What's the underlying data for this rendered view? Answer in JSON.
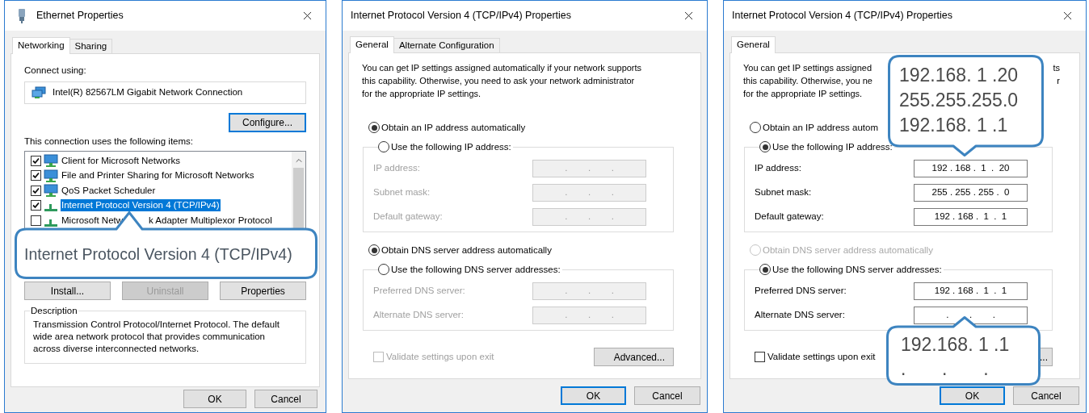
{
  "dialogs": [
    {
      "kind": "ethernet",
      "title": "Ethernet Properties",
      "tabs": [
        {
          "label": "Networking",
          "selected": true
        },
        {
          "label": "Sharing",
          "selected": false
        }
      ],
      "connect_label": "Connect using:",
      "adapter": "Intel(R) 82567LM Gigabit Network Connection",
      "configure_button": "Configure...",
      "items_label": "This connection uses the following items:",
      "items": [
        {
          "label": "Client for Microsoft Networks",
          "kind": "client",
          "checked": true,
          "selected": false
        },
        {
          "label": "File and Printer Sharing for Microsoft Networks",
          "kind": "client",
          "checked": true,
          "selected": false
        },
        {
          "label": "QoS Packet Scheduler",
          "kind": "client",
          "checked": true,
          "selected": false
        },
        {
          "label": "Internet Protocol Version 4 (TCP/IPv4)",
          "kind": "protocol",
          "checked": true,
          "selected": true
        },
        {
          "label": "Microsoft Netw",
          "tail": "k Adapter Multiplexor Protocol",
          "kind": "protocol",
          "checked": false,
          "selected": false
        }
      ],
      "buttons": [
        {
          "label": "Install...",
          "disabled": false
        },
        {
          "label": "Uninstall",
          "disabled": true
        },
        {
          "label": "Properties",
          "disabled": false
        }
      ],
      "description": {
        "legend": "Description",
        "text": "Transmission Control Protocol/Internet Protocol. The default wide area network protocol that provides communication across diverse interconnected networks."
      },
      "footer": [
        {
          "label": "OK",
          "focused": false
        },
        {
          "label": "Cancel",
          "focused": false
        }
      ],
      "callouts": [
        {
          "kind": "protocol",
          "lines": [
            "Internet Protocol Version 4 (TCP/IPv4)"
          ]
        }
      ]
    },
    {
      "kind": "ipv4",
      "title": "Internet Protocol Version 4 (TCP/IPv4) Properties",
      "tabs": [
        {
          "label": "General",
          "selected": true
        },
        {
          "label": "Alternate Configuration",
          "selected": false
        }
      ],
      "intro": [
        {
          "text": "You can get IP settings assigned automatically if your network supports"
        },
        {
          "text": "this capability. Otherwise, you need to ask your network administrator"
        },
        {
          "text": "for the appropriate IP settings."
        }
      ],
      "ip_modes": [
        {
          "label": "Obtain an IP address automatically",
          "selected": true,
          "disabled": false
        },
        {
          "label": "Use the following IP address:",
          "selected": false,
          "disabled": false
        }
      ],
      "ip_fields": [
        {
          "label": "IP address:",
          "value": ".        .        .",
          "disabled": true
        },
        {
          "label": "Subnet mask:",
          "value": ".        .        .",
          "disabled": true
        },
        {
          "label": "Default gateway:",
          "value": ".        .        .",
          "disabled": true
        }
      ],
      "dns_modes": [
        {
          "label": "Obtain DNS server address automatically",
          "selected": true,
          "disabled": false
        },
        {
          "label": "Use the following DNS server addresses:",
          "selected": false,
          "disabled": false
        }
      ],
      "dns_fields": [
        {
          "label": "Preferred DNS server:",
          "value": ".        .        .",
          "disabled": true
        },
        {
          "label": "Alternate DNS server:",
          "value": ".        .        .",
          "disabled": true
        }
      ],
      "validate": {
        "label": "Validate settings upon exit",
        "checked": false,
        "disabled": true
      },
      "advanced_button": "Advanced...",
      "footer": [
        {
          "label": "OK",
          "focused": true
        },
        {
          "label": "Cancel",
          "focused": false
        }
      ]
    },
    {
      "kind": "ipv4",
      "title": "Internet Protocol Version 4 (TCP/IPv4) Properties",
      "tabs": [
        {
          "label": "General",
          "selected": true
        }
      ],
      "intro": [
        {
          "text": "You can get IP settings assigned",
          "tail": "ts"
        },
        {
          "text": "this capability. Otherwise, you ne",
          "tail": "r"
        },
        {
          "text": "for the appropriate IP settings."
        }
      ],
      "ip_modes": [
        {
          "label": "Obtain an IP address autom",
          "selected": false,
          "disabled": false
        },
        {
          "label": "Use the following IP address:",
          "selected": true,
          "disabled": false
        }
      ],
      "ip_fields": [
        {
          "label": "IP address:",
          "value": "192 . 168 .  1  .  20",
          "disabled": false
        },
        {
          "label": "Subnet mask:",
          "value": "255 . 255 . 255 .  0",
          "disabled": false
        },
        {
          "label": "Default gateway:",
          "value": "192 . 168 .  1  .  1",
          "disabled": false
        }
      ],
      "dns_modes": [
        {
          "label": "Obtain DNS server address automatically",
          "selected": false,
          "disabled": true
        },
        {
          "label": "Use the following DNS server addresses:",
          "selected": true,
          "disabled": false
        }
      ],
      "dns_fields": [
        {
          "label": "Preferred DNS server:",
          "value": "192 . 168 .  1  .  1",
          "disabled": false
        },
        {
          "label": "Alternate DNS server:",
          "value": ".        .        .",
          "disabled": false
        }
      ],
      "validate": {
        "label": "Validate settings upon exit",
        "checked": false,
        "disabled": false
      },
      "advanced_button": "...",
      "footer": [
        {
          "label": "OK",
          "focused": true
        },
        {
          "label": "Cancel",
          "focused": false
        }
      ],
      "callouts": [
        {
          "kind": "ip",
          "lines": [
            "192.168. 1 .20",
            "255.255.255.0",
            "192.168. 1 .1"
          ]
        },
        {
          "kind": "dns",
          "lines": [
            "192.168. 1 .1",
            ".       .       ."
          ]
        }
      ]
    }
  ]
}
